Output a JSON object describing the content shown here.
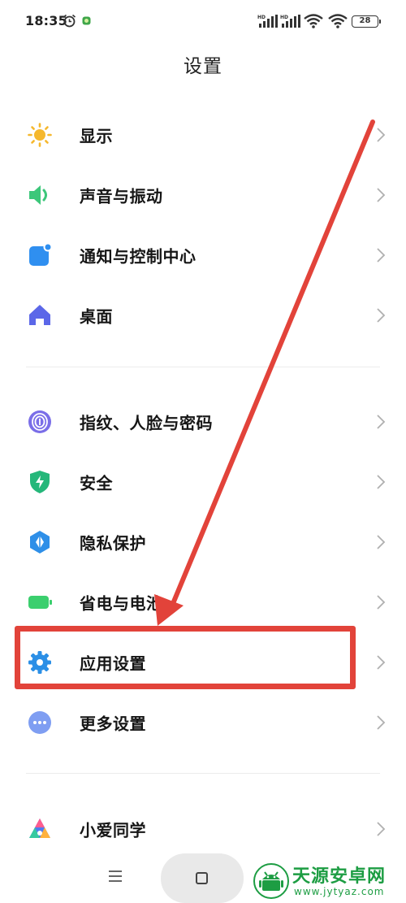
{
  "status_bar": {
    "time": "18:35",
    "battery": "28"
  },
  "title": "设置",
  "sections": [
    {
      "items": [
        {
          "label": "显示",
          "icon": "sun-icon"
        },
        {
          "label": "声音与振动",
          "icon": "speaker-icon"
        },
        {
          "label": "通知与控制中心",
          "icon": "notification-icon"
        },
        {
          "label": "桌面",
          "icon": "home-icon"
        }
      ]
    },
    {
      "items": [
        {
          "label": "指纹、人脸与密码",
          "icon": "fingerprint-icon"
        },
        {
          "label": "安全",
          "icon": "shield-icon"
        },
        {
          "label": "隐私保护",
          "icon": "privacy-icon"
        },
        {
          "label": "省电与电池",
          "icon": "battery-icon"
        },
        {
          "label": "应用设置",
          "icon": "gear-icon"
        },
        {
          "label": "更多设置",
          "icon": "more-icon"
        }
      ]
    },
    {
      "items": [
        {
          "label": "小爱同学",
          "icon": "xiaoai-icon"
        }
      ]
    }
  ],
  "annotation": {
    "highlighted_item": "应用设置",
    "color": "#e2433a"
  },
  "nav_bar": {
    "menu_icon": "menu-icon",
    "home_icon": "home-button-icon"
  },
  "watermark": {
    "name": "天源安卓网",
    "url": "www.jytyaz.com"
  }
}
